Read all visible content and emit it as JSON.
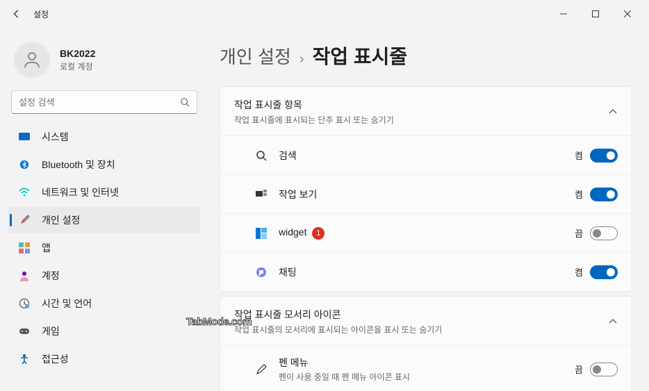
{
  "window": {
    "title": "설정"
  },
  "user": {
    "name": "BK2022",
    "subtitle": "로컬 계정"
  },
  "search": {
    "placeholder": "설정 검색"
  },
  "nav": {
    "system": "시스템",
    "bluetooth": "Bluetooth 및 장치",
    "network": "네트워크 및 인터넷",
    "personalize": "개인 설정",
    "apps": "앱",
    "accounts": "계정",
    "time": "시간 및 언어",
    "gaming": "게임",
    "accessibility": "접근성"
  },
  "breadcrumb": {
    "parent": "개인 설정",
    "current": "작업 표시줄"
  },
  "section1": {
    "title": "작업 표시줄 항목",
    "subtitle": "작업 표시줄에 표시되는 단추 표시 또는 숨기기",
    "items": {
      "search": {
        "label": "검색",
        "state": "켬"
      },
      "taskview": {
        "label": "작업 보기",
        "state": "켬"
      },
      "widget": {
        "label": "widget",
        "badge": "1",
        "state": "끔"
      },
      "chat": {
        "label": "채팅",
        "state": "켬"
      }
    }
  },
  "section2": {
    "title": "작업 표시줄 모서리 아이콘",
    "subtitle": "작업 표시줄의 모서리에 표시되는 아이콘을 표시 또는 숨기기",
    "items": {
      "pen": {
        "label": "펜 메뉴",
        "sub": "펜이 사용 중일 때 펜 메뉴 아이콘 표시",
        "state": "끔"
      }
    }
  },
  "watermark": "TabMode.com"
}
